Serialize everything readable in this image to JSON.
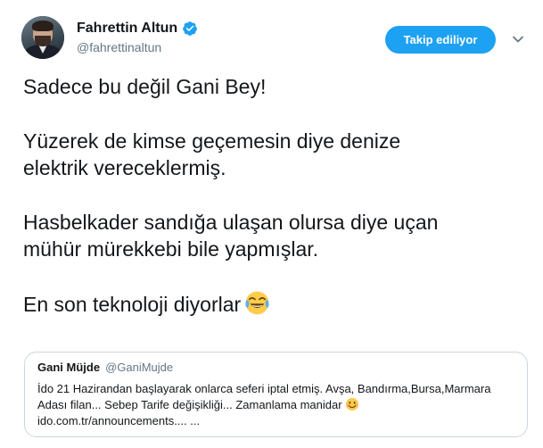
{
  "author": {
    "name": "Fahrettin Altun",
    "handle": "@fahrettinaltun",
    "verified": true
  },
  "actions": {
    "follow_label": "Takip ediliyor"
  },
  "icons": {
    "verified": "verified-badge-icon",
    "caret": "chevron-down-icon",
    "tweet_emoji": "face-with-tears-of-joy-emoji",
    "quote_emoji": "smiling-face-emoji"
  },
  "colors": {
    "accent": "#1da1f2",
    "secondary_text": "#657786",
    "border": "#ccd6dd"
  },
  "tweet": {
    "line1": "Sadece bu değil Gani Bey!",
    "line2a": "Yüzerek de kimse geçemesin diye denize",
    "line2b": "elektrik vereceklermiş.",
    "line3a": "Hasbelkader sandığa ulaşan olursa diye uçan",
    "line3b": "mühür mürekkebi bile yapmışlar.",
    "line4": "En son teknoloji diyorlar"
  },
  "quoted_tweet": {
    "name": "Gani Müjde",
    "handle": "@GaniMujde",
    "body_line1": "İdo 21 Hazirandan başlayarak onlarca seferi iptal etmiş. Avşa, Bandırma,Bursa,Marmara",
    "body_line2": "Adası filan... Sebep Tarife değişikliği... Zamanlama manidar",
    "body_line3": "ido.com.tr/announcements.... ..."
  }
}
